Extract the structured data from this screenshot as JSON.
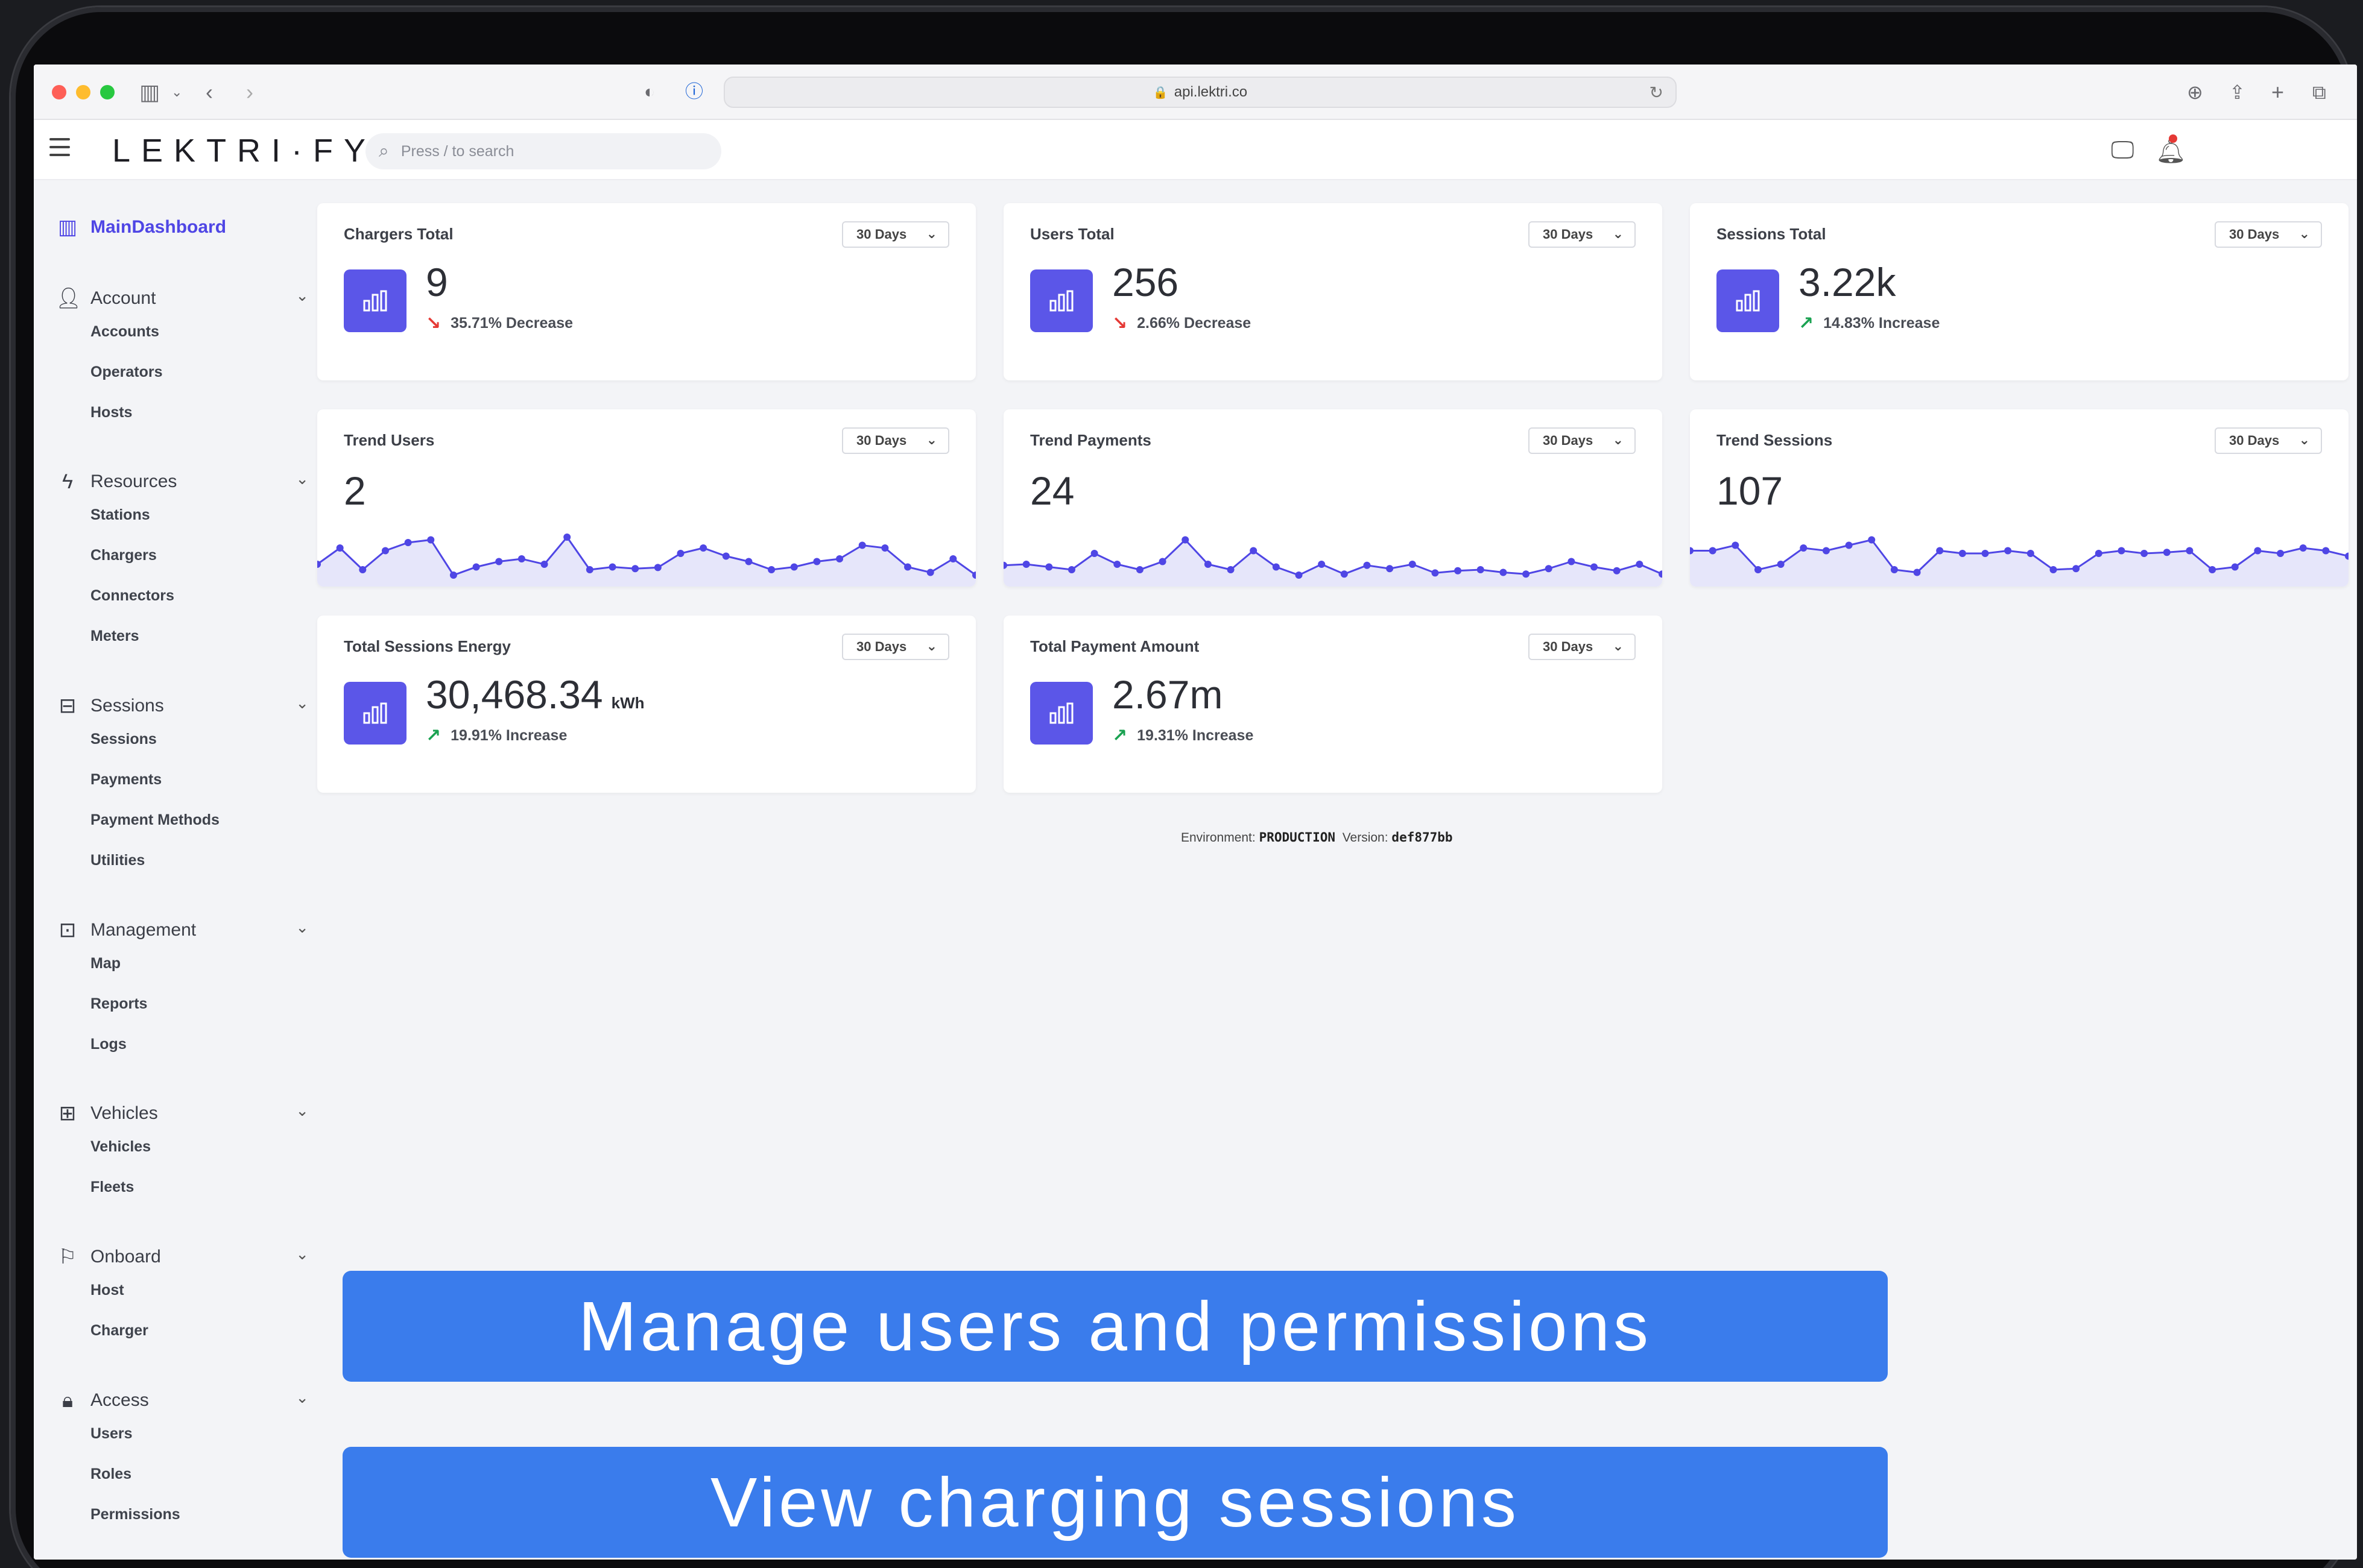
{
  "browser": {
    "url": "api.lektri.co"
  },
  "app": {
    "logo": "LEKTRI·FY",
    "search_placeholder": "Press / to search"
  },
  "sidebar": {
    "main": "MainDashboard",
    "sections": [
      {
        "label": "Account",
        "items": [
          "Accounts",
          "Operators",
          "Hosts"
        ]
      },
      {
        "label": "Resources",
        "items": [
          "Stations",
          "Chargers",
          "Connectors",
          "Meters"
        ]
      },
      {
        "label": "Sessions",
        "items": [
          "Sessions",
          "Payments",
          "Payment Methods",
          "Utilities"
        ]
      },
      {
        "label": "Management",
        "items": [
          "Map",
          "Reports",
          "Logs"
        ]
      },
      {
        "label": "Vehicles",
        "items": [
          "Vehicles",
          "Fleets"
        ]
      },
      {
        "label": "Onboard",
        "items": [
          "Host",
          "Charger"
        ]
      },
      {
        "label": "Access",
        "items": [
          "Users",
          "Roles",
          "Permissions"
        ]
      }
    ]
  },
  "range_label": "30 Days",
  "cards": {
    "chargers_total": {
      "title": "Chargers Total",
      "value": "9",
      "change": "35.71% Decrease"
    },
    "users_total": {
      "title": "Users Total",
      "value": "256",
      "change": "2.66% Decrease"
    },
    "sessions_total": {
      "title": "Sessions Total",
      "value": "3.22k",
      "change": "14.83% Increase"
    },
    "trend_users": {
      "title": "Trend Users",
      "value": "2"
    },
    "trend_payments": {
      "title": "Trend Payments",
      "value": "24"
    },
    "trend_sessions": {
      "title": "Trend Sessions",
      "value": "107"
    },
    "total_energy": {
      "title": "Total Sessions Energy",
      "value": "30,468.34",
      "unit": "kWh",
      "change": "19.91% Increase"
    },
    "total_payment": {
      "title": "Total Payment Amount",
      "value": "2.67m",
      "change": "19.31% Increase"
    }
  },
  "footer": {
    "env_label": "Environment:",
    "env_value": "PRODUCTION",
    "version_label": "Version:",
    "version_value": "def877bb"
  },
  "banners": {
    "first": "Manage users and permissions",
    "second": "View charging sessions"
  },
  "colors": {
    "accent": "#4f46e5",
    "icon_bg": "#5b56e8",
    "decrease": "#e53935",
    "increase": "#1aa251",
    "banner": "#3a7cec"
  }
}
